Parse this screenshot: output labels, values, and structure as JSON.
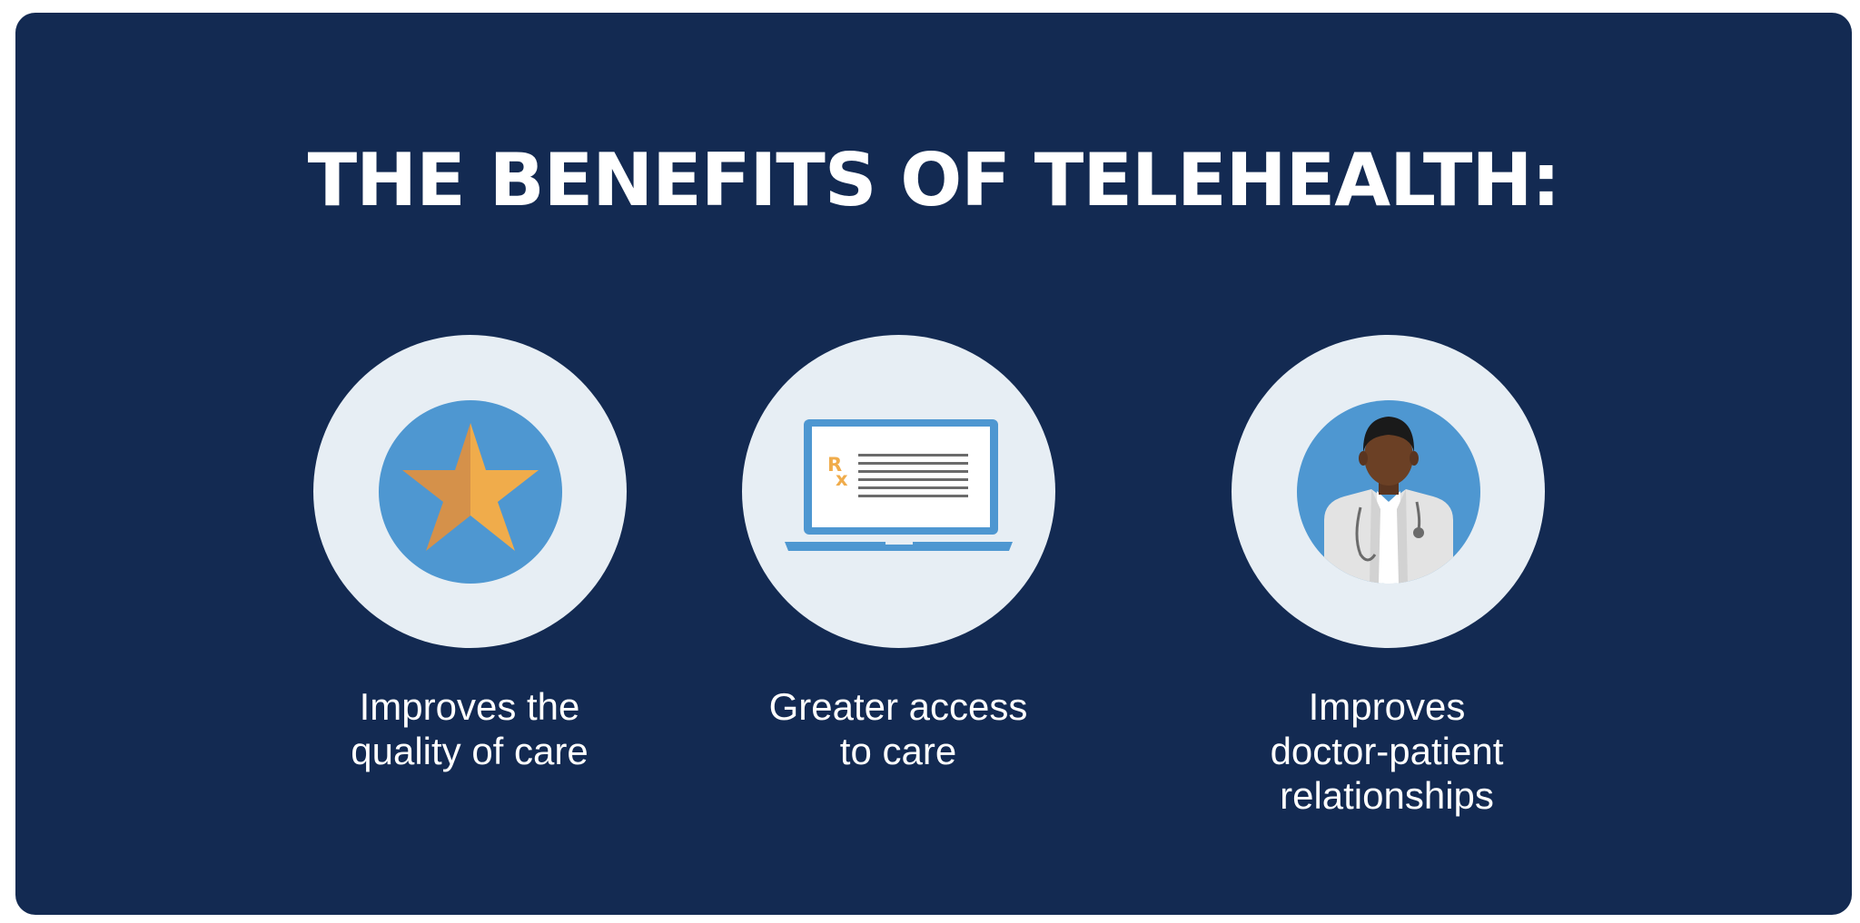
{
  "title": "THE BENEFITS OF TELEHEALTH:",
  "benefits": [
    {
      "icon": "star-icon",
      "caption_lines": [
        "Improves the",
        "quality of care"
      ]
    },
    {
      "icon": "laptop-prescription-icon",
      "icon_text": "Rx",
      "caption_lines": [
        "Greater access",
        "to care"
      ]
    },
    {
      "icon": "doctor-icon",
      "caption_lines": [
        "Improves",
        "doctor-patient",
        "relationships"
      ]
    }
  ],
  "colors": {
    "background": "#132a52",
    "outer_circle": "#e7eef4",
    "inner_circle": "#4e97d1",
    "star_light": "#f0ac4b",
    "star_dark": "#d5914a",
    "laptop_frame": "#4e97d1",
    "text": "#ffffff"
  }
}
